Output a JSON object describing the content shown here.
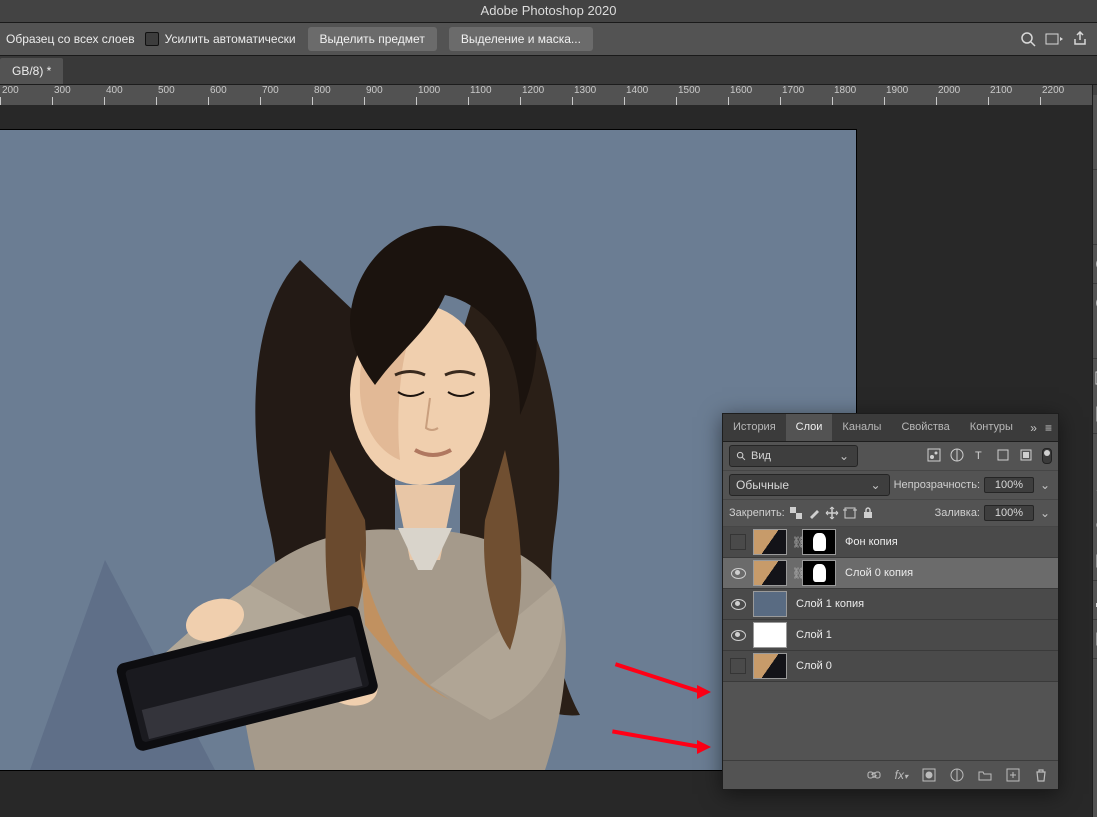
{
  "app_title": "Adobe Photoshop 2020",
  "options_bar": {
    "sample_label": "Образец со всех слоев",
    "enhance_label": "Усилить автоматически",
    "select_subject": "Выделить предмет",
    "select_and_mask": "Выделение и маска..."
  },
  "doc_tab": "GB/8) *",
  "ruler_ticks": [
    "200",
    "300",
    "400",
    "500",
    "600",
    "700",
    "800",
    "900",
    "1000",
    "1100",
    "1200",
    "1300",
    "1400",
    "1500",
    "1600",
    "1700",
    "1800",
    "1900",
    "2000",
    "2100",
    "2200"
  ],
  "panel": {
    "tabs": [
      "История",
      "Слои",
      "Каналы",
      "Свойства",
      "Контуры"
    ],
    "active_tab": 1,
    "search_label": "Вид",
    "blend_mode": "Обычные",
    "opacity_label": "Непрозрачность:",
    "opacity_value": "100%",
    "lock_label": "Закрепить:",
    "fill_label": "Заливка:",
    "fill_value": "100%"
  },
  "layers": [
    {
      "visible": false,
      "thumb": "photo",
      "mask": true,
      "name": "Фон копия",
      "selected": false
    },
    {
      "visible": true,
      "thumb": "photo",
      "mask": true,
      "name": "Слой 0 копия",
      "selected": true
    },
    {
      "visible": true,
      "thumb": "solid",
      "mask": false,
      "name": "Слой 1 копия",
      "selected": false
    },
    {
      "visible": true,
      "thumb": "white",
      "mask": false,
      "name": "Слой 1",
      "selected": false
    },
    {
      "visible": false,
      "thumb": "photo",
      "mask": false,
      "name": "Слой 0",
      "selected": false
    }
  ]
}
